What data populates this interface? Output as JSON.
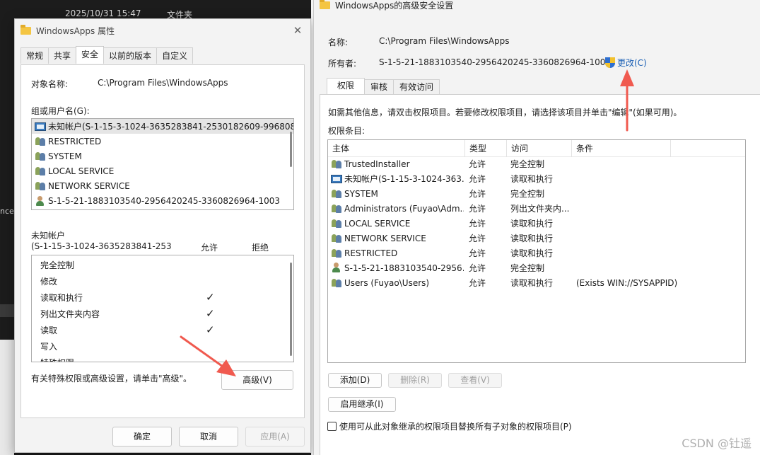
{
  "background": {
    "datetime": "2025/10/31 15:47",
    "folder_type": "文件夹",
    "side_fragment": "nced"
  },
  "left_dialog": {
    "title": "WindowsApps 属性",
    "tabs": [
      "常规",
      "共享",
      "安全",
      "以前的版本",
      "自定义"
    ],
    "object_name_label": "对象名称:",
    "object_name_value": "C:\\Program Files\\WindowsApps",
    "group_label": "组或用户名(G):",
    "groups": [
      {
        "name": "未知帐户(S-1-15-3-1024-3635283841-2530182609-996808",
        "icon": "unknown-account-icon"
      },
      {
        "name": "RESTRICTED",
        "icon": "group-icon"
      },
      {
        "name": "SYSTEM",
        "icon": "group-icon"
      },
      {
        "name": "LOCAL SERVICE",
        "icon": "group-icon"
      },
      {
        "name": "NETWORK SERVICE",
        "icon": "group-icon"
      },
      {
        "name": "S-1-5-21-1883103540-2956420245-3360826964-1003",
        "icon": "user-icon"
      }
    ],
    "perm_for_line1": "未知帐户",
    "perm_for_line2": "(S-1-15-3-1024-3635283841-253",
    "allow_label": "允许",
    "deny_label": "拒绝",
    "permissions": [
      {
        "name": "完全控制",
        "allow": false
      },
      {
        "name": "修改",
        "allow": false
      },
      {
        "name": "读取和执行",
        "allow": true
      },
      {
        "name": "列出文件夹内容",
        "allow": true
      },
      {
        "name": "读取",
        "allow": true
      },
      {
        "name": "写入",
        "allow": false
      },
      {
        "name": "特殊权限",
        "allow": false
      }
    ],
    "check_glyph": "✓",
    "advanced_hint": "有关特殊权限或高级设置，请单击\"高级\"。",
    "advanced_button": "高级(V)",
    "ok_button": "确定",
    "cancel_button": "取消",
    "apply_button": "应用(A)",
    "close_glyph": "✕"
  },
  "right_dialog": {
    "title": "WindowsApps的高级安全设置",
    "name_label": "名称:",
    "name_value": "C:\\Program Files\\WindowsApps",
    "owner_label": "所有者:",
    "owner_value": "S-1-5-21-1883103540-2956420245-3360826964-1003",
    "change_link": "更改(C)",
    "tabs": [
      "权限",
      "审核",
      "有效访问"
    ],
    "info_text": "如需其他信息，请双击权限项目。若要修改权限项目，请选择该项目并单击\"编辑\"(如果可用)。",
    "entries_label": "权限条目:",
    "columns": [
      "主体",
      "类型",
      "访问",
      "条件"
    ],
    "entries": [
      {
        "principal": "TrustedInstaller",
        "type": "允许",
        "access": "完全控制",
        "condition": "",
        "icon": "group-icon"
      },
      {
        "principal": "未知帐户(S-1-15-3-1024-363...",
        "type": "允许",
        "access": "读取和执行",
        "condition": "",
        "icon": "unknown-account-icon"
      },
      {
        "principal": "SYSTEM",
        "type": "允许",
        "access": "完全控制",
        "condition": "",
        "icon": "group-icon"
      },
      {
        "principal": "Administrators (Fuyao\\Adm...",
        "type": "允许",
        "access": "列出文件夹内...",
        "condition": "",
        "icon": "group-icon"
      },
      {
        "principal": "LOCAL SERVICE",
        "type": "允许",
        "access": "读取和执行",
        "condition": "",
        "icon": "group-icon"
      },
      {
        "principal": "NETWORK SERVICE",
        "type": "允许",
        "access": "读取和执行",
        "condition": "",
        "icon": "group-icon"
      },
      {
        "principal": "RESTRICTED",
        "type": "允许",
        "access": "读取和执行",
        "condition": "",
        "icon": "group-icon"
      },
      {
        "principal": "S-1-5-21-1883103540-2956...",
        "type": "允许",
        "access": "完全控制",
        "condition": "",
        "icon": "user-icon"
      },
      {
        "principal": "Users (Fuyao\\Users)",
        "type": "允许",
        "access": "读取和执行",
        "condition": "(Exists WIN://SYSAPPID)",
        "icon": "group-icon"
      }
    ],
    "add_button": "添加(D)",
    "remove_button": "删除(R)",
    "view_button": "查看(V)",
    "inherit_button": "启用继承(I)",
    "replace_checkbox_label": "使用可从此对象继承的权限项目替换所有子对象的权限项目(P)"
  },
  "watermark": "CSDN @钍遥",
  "colors": {
    "arrow": "#f05a4f",
    "link": "#1a5fb4"
  }
}
